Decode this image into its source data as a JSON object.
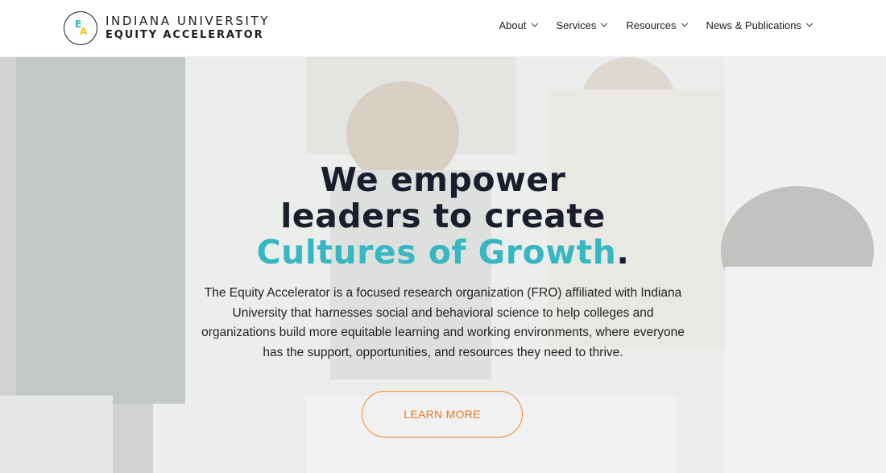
{
  "logo": {
    "mark_letters": [
      "E",
      "A"
    ],
    "line1": "INDIANA UNIVERSITY",
    "line2": "EQUITY ACCELERATOR"
  },
  "nav": {
    "items": [
      {
        "label": "About",
        "icon": "chevron-down-icon"
      },
      {
        "label": "Services",
        "icon": "chevron-down-icon"
      },
      {
        "label": "Resources",
        "icon": "chevron-down-icon"
      },
      {
        "label": "News & Publications",
        "icon": "chevron-down-icon"
      }
    ]
  },
  "hero": {
    "headline_line1": "We empower",
    "headline_line2": "leaders to create",
    "headline_accent": "Cultures of Growth",
    "headline_end": ".",
    "description": "The Equity Accelerator is a focused research organization (FRO) affiliated with Indiana University that harnesses social and behavioral science to help colleges and organizations build more equitable learning and working environments, where everyone has the support, opportunities, and resources they need to thrive.",
    "cta_label": "LEARN MORE"
  },
  "colors": {
    "accent_teal": "#36b7c2",
    "cta_orange": "#f28a2e",
    "logo_yellow": "#f2c21b",
    "text_dark": "#1a1d2b"
  }
}
